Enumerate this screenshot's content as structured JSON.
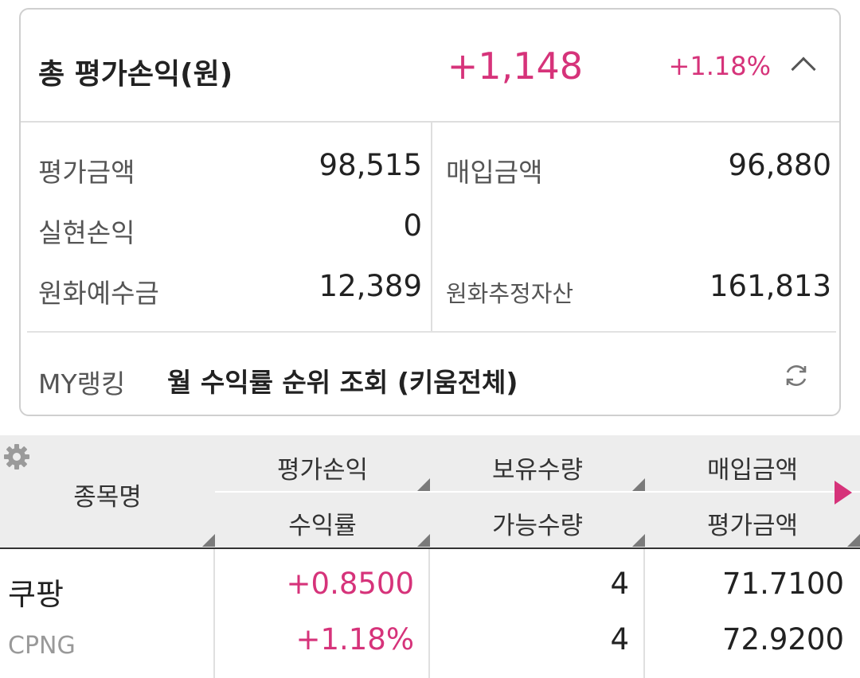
{
  "summary": {
    "total_label": "총 평가손익(원)",
    "total_value": "+1,148",
    "total_rate": "+1.18%",
    "collapse_icon": "chevron-up-icon",
    "eval_amount_label": "평가금액",
    "eval_amount_value": "98,515",
    "purchase_amount_label": "매입금액",
    "purchase_amount_value": "96,880",
    "realized_pl_label": "실현손익",
    "realized_pl_value": "0",
    "krw_deposit_label": "원화예수금",
    "krw_deposit_value": "12,389",
    "krw_est_assets_label": "원화추정자산",
    "krw_est_assets_value": "161,813"
  },
  "ranking": {
    "label": "MY랭킹",
    "text": "월 수익률 순위 조회 (키움전체)",
    "icon": "refresh-icon"
  },
  "table": {
    "settings_icon": "gear-icon",
    "more_icon": "play-icon",
    "headers": {
      "name": "종목명",
      "eval_pl": "평가손익",
      "holding_qty": "보유수량",
      "purchase_amount": "매입금액",
      "return_rate": "수익률",
      "available_qty": "가능수량",
      "eval_amount": "평가금액"
    },
    "rows": [
      {
        "name": "쿠팡",
        "code": "CPNG",
        "eval_pl": "+0.8500",
        "return_rate": "+1.18%",
        "holding_qty": "4",
        "available_qty": "4",
        "purchase_amount": "71.7100",
        "eval_amount": "72.9200"
      }
    ]
  },
  "colors": {
    "accent_pink": "#d6337a",
    "header_bg": "#ededed",
    "border": "#cfcfcf"
  }
}
